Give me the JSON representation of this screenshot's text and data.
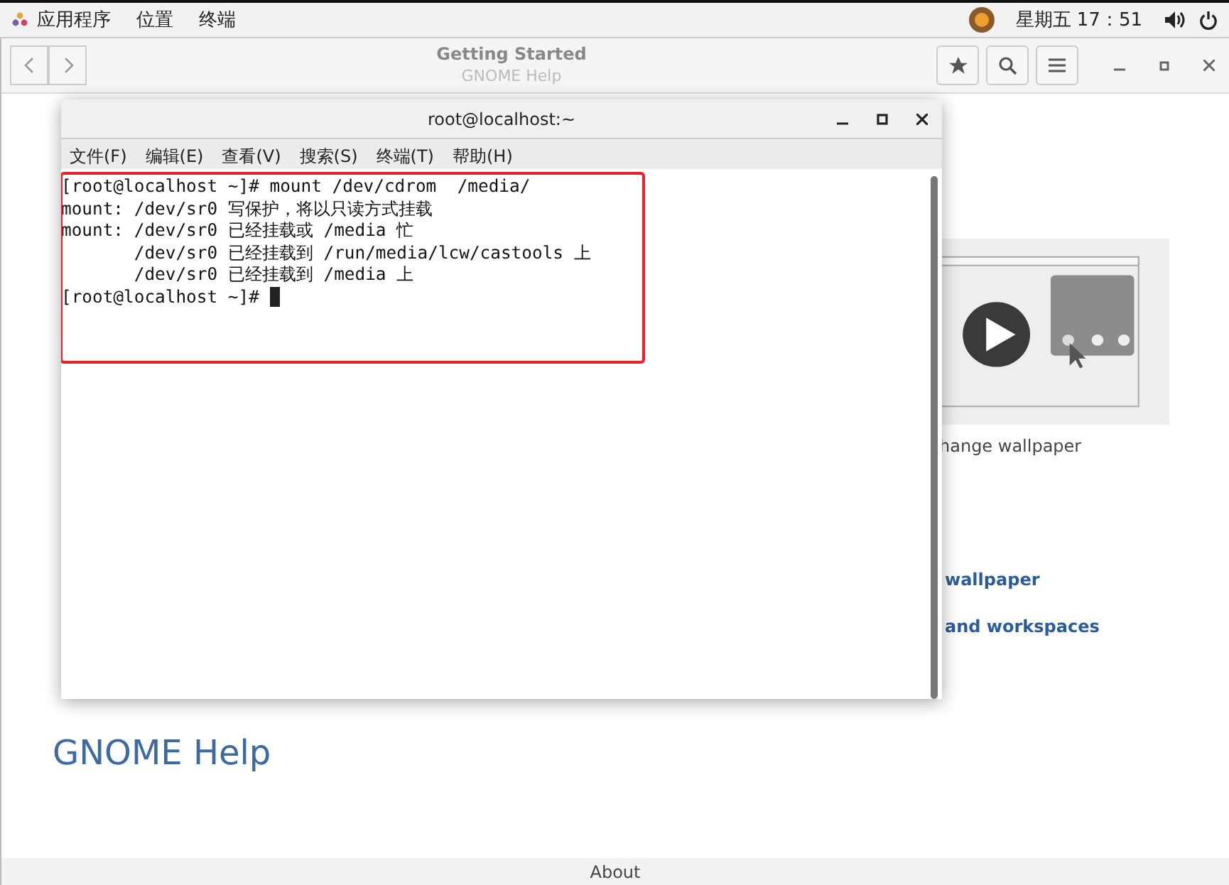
{
  "top_bar": {
    "menus": [
      "应用程序",
      "位置",
      "终端"
    ],
    "clock": "星期五 17：51"
  },
  "help_window": {
    "title": "Getting Started",
    "subtitle": "GNOME Help",
    "video_caption": "hange wallpaper",
    "links": [
      "wallpaper",
      "and workspaces"
    ],
    "footer_heading": "GNOME Help",
    "about": "About"
  },
  "terminal": {
    "title": "root@localhost:~",
    "menus": [
      "文件(F)",
      "编辑(E)",
      "查看(V)",
      "搜索(S)",
      "终端(T)",
      "帮助(H)"
    ],
    "lines": [
      "[root@localhost ~]# mount /dev/cdrom  /media/",
      "mount: /dev/sr0 写保护，将以只读方式挂载",
      "mount: /dev/sr0 已经挂载或 /media 忙",
      "       /dev/sr0 已经挂载到 /run/media/lcw/castools 上",
      "       /dev/sr0 已经挂载到 /media 上",
      "[root@localhost ~]# "
    ]
  }
}
